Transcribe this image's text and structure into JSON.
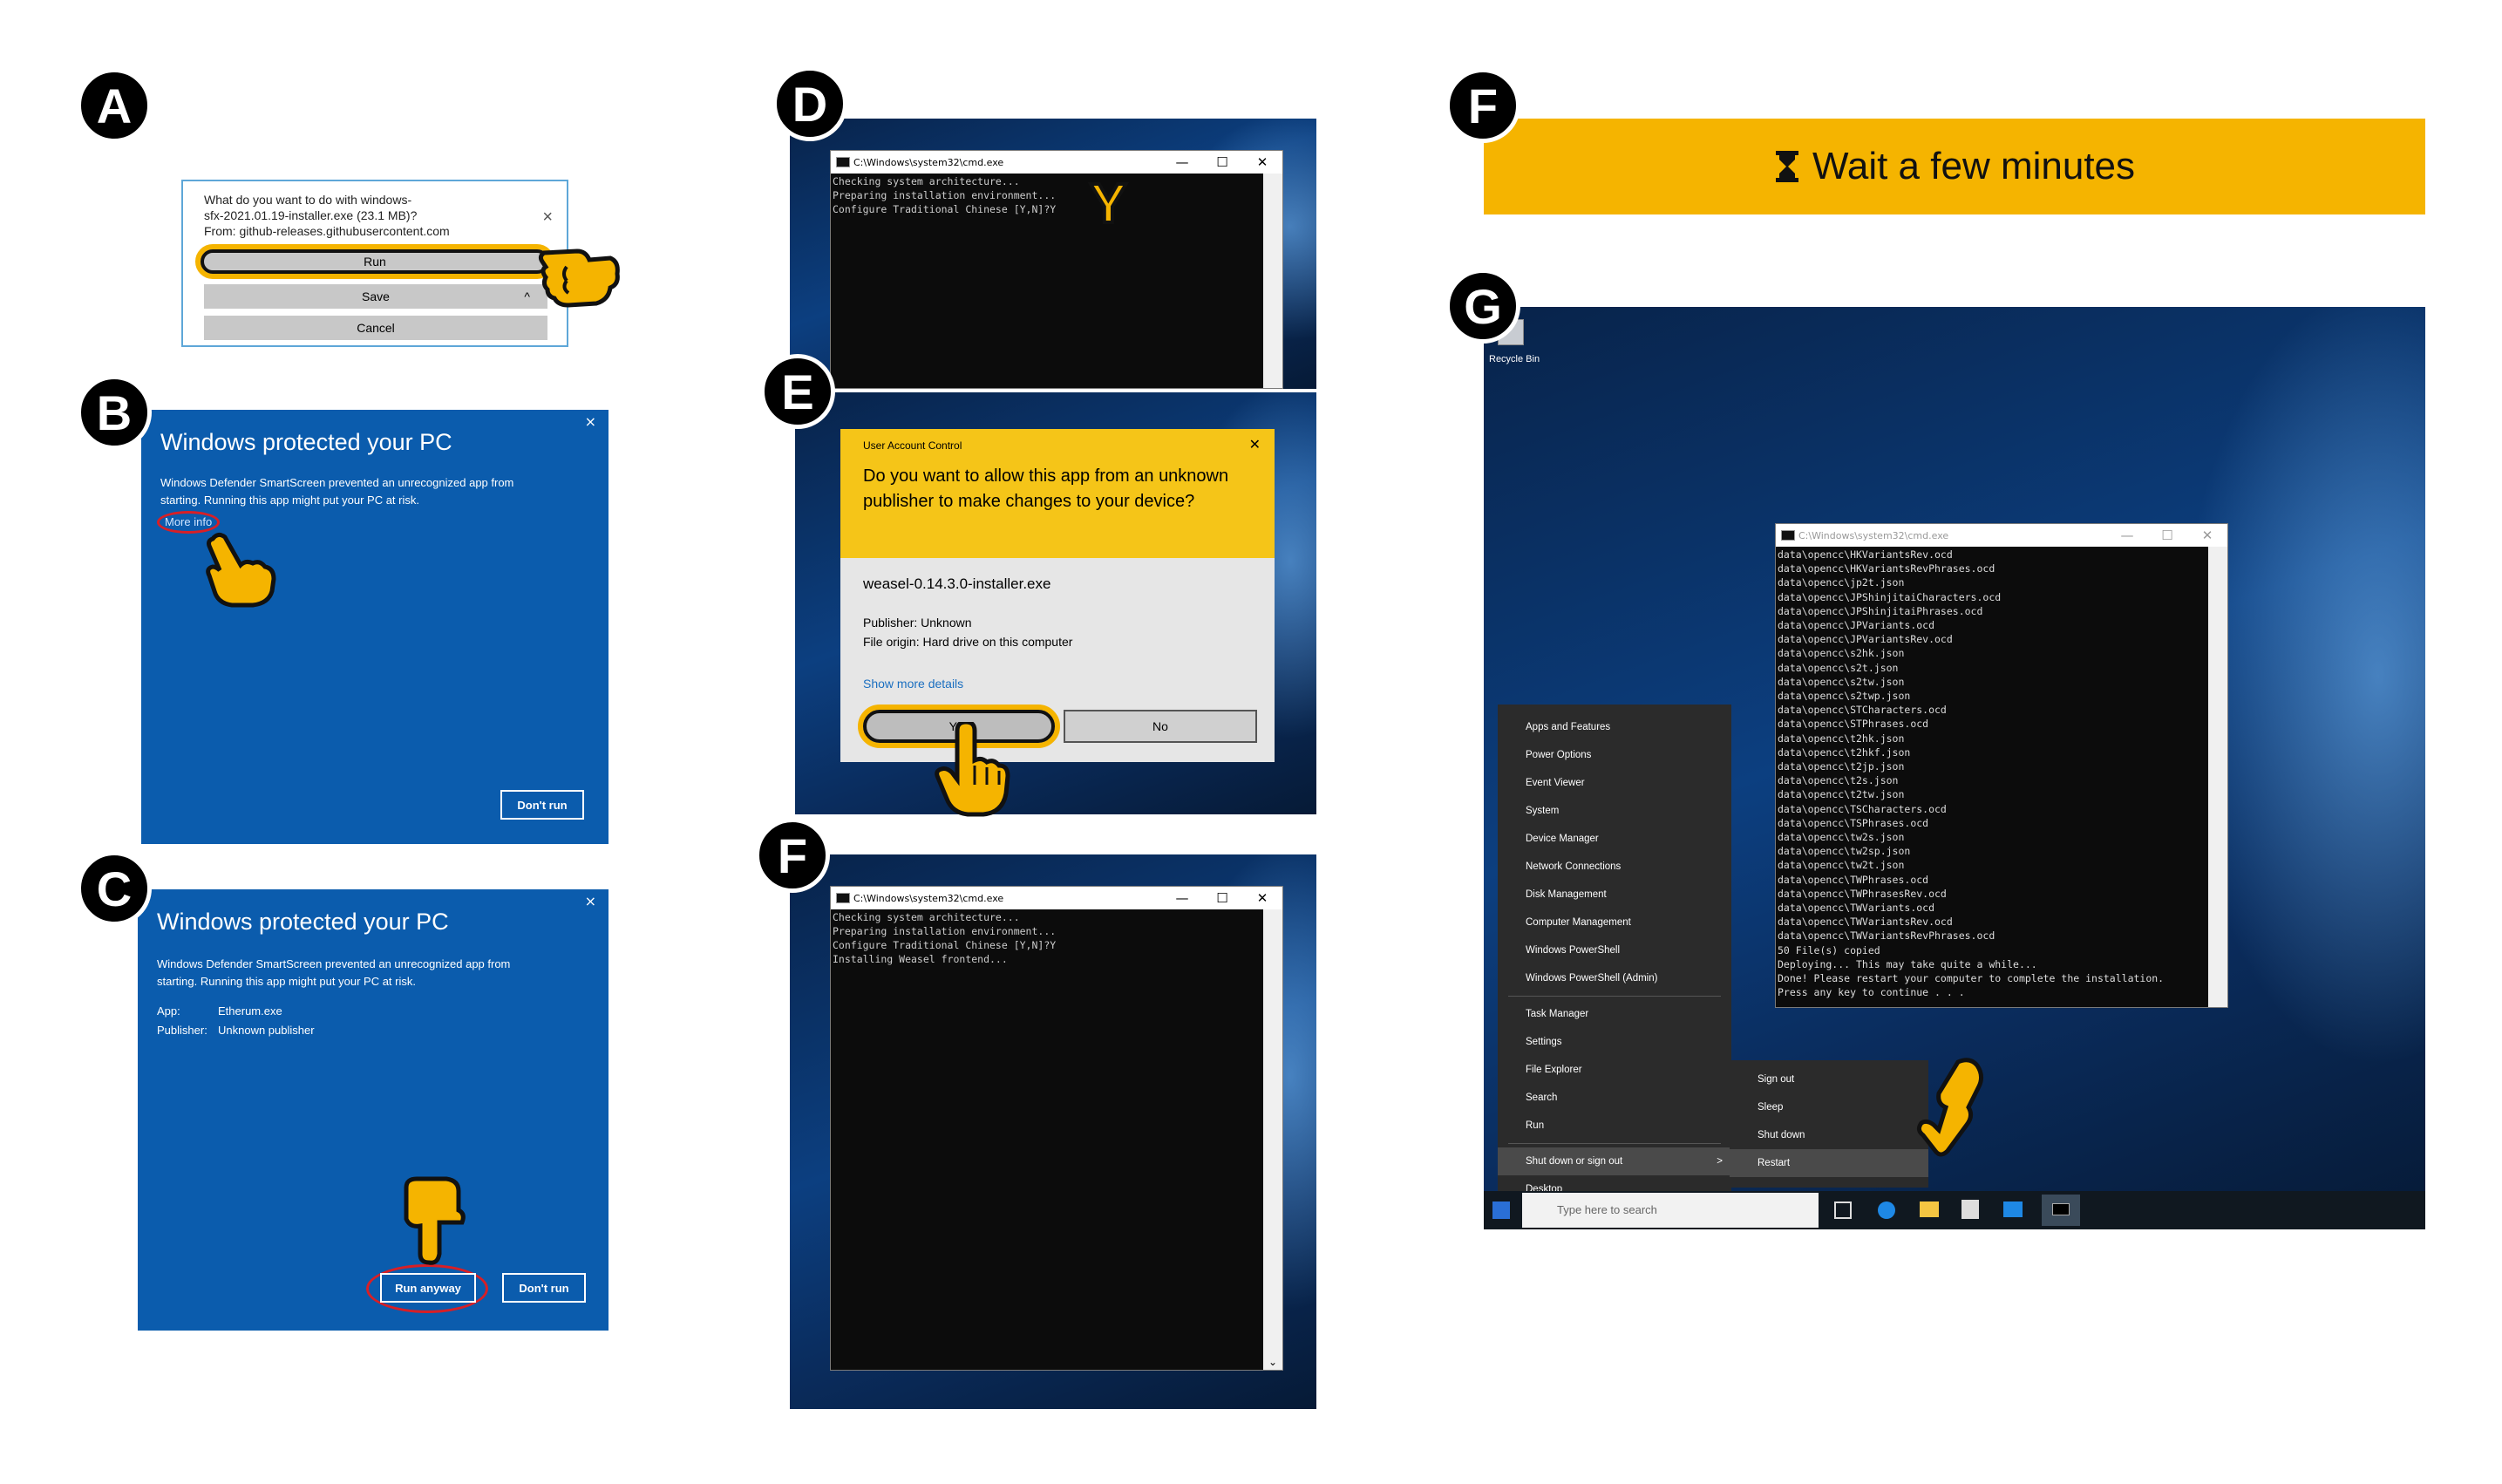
{
  "steps": {
    "a": "A",
    "b": "B",
    "c": "C",
    "d": "D",
    "e": "E",
    "f1": "F",
    "f2": "F",
    "g": "G"
  },
  "panel_a": {
    "prompt_line1": "What do you want to do with windows-",
    "prompt_line2": "sfx-2021.01.19-installer.exe (23.1 MB)?",
    "prompt_line3": "From: github-releases.githubusercontent.com",
    "close": "×",
    "run": "Run",
    "save": "Save",
    "caret": "^",
    "cancel": "Cancel"
  },
  "panel_b": {
    "title": "Windows protected your PC",
    "message_line1": "Windows Defender SmartScreen prevented an unrecognized app from",
    "message_line2": "starting. Running this app might put your PC at risk.",
    "more_info": "More info",
    "dont_run": "Don't run",
    "close": "×"
  },
  "panel_c": {
    "title": "Windows protected your PC",
    "message_line1": "Windows Defender SmartScreen prevented an unrecognized app from",
    "message_line2": "starting. Running this app might put your PC at risk.",
    "app_label": "App:",
    "app_value": "Etherum.exe",
    "publisher_label": "Publisher:",
    "publisher_value": "Unknown publisher",
    "run_anyway": "Run anyway",
    "dont_run": "Don't run",
    "close": "×"
  },
  "panel_d": {
    "window_title": "C:\\Windows\\system32\\cmd.exe",
    "console": "Checking system architecture...\nPreparing installation environment...\nConfigure Traditional Chinese [Y,N]?Y",
    "big_key": "Y",
    "min": "—",
    "max": "☐",
    "close": "✕"
  },
  "panel_e": {
    "header": "User Account Control",
    "question": "Do you want to allow this app from an unknown publisher to make changes to your device?",
    "app_name": "weasel-0.14.3.0-installer.exe",
    "publisher": "Publisher: Unknown",
    "origin": "File origin: Hard drive on this computer",
    "details_link": "Show more details",
    "yes": "Yes",
    "no": "No",
    "close": "✕"
  },
  "panel_f": {
    "window_title": "C:\\Windows\\system32\\cmd.exe",
    "console": "Checking system architecture...\nPreparing installation environment...\nConfigure Traditional Chinese [Y,N]?Y\nInstalling Weasel frontend...",
    "min": "—",
    "max": "☐",
    "close": "✕",
    "scroll_down": "⌄"
  },
  "banner": {
    "icon": "hourglass-icon",
    "text": "Wait a few minutes",
    "color": "#f5b400"
  },
  "panel_g": {
    "recycle_bin": "Recycle Bin",
    "window_title": "C:\\Windows\\system32\\cmd.exe",
    "console": "data\\opencc\\HKVariantsRev.ocd\ndata\\opencc\\HKVariantsRevPhrases.ocd\ndata\\opencc\\jp2t.json\ndata\\opencc\\JPShinjitaiCharacters.ocd\ndata\\opencc\\JPShinjitaiPhrases.ocd\ndata\\opencc\\JPVariants.ocd\ndata\\opencc\\JPVariantsRev.ocd\ndata\\opencc\\s2hk.json\ndata\\opencc\\s2t.json\ndata\\opencc\\s2tw.json\ndata\\opencc\\s2twp.json\ndata\\opencc\\STCharacters.ocd\ndata\\opencc\\STPhrases.ocd\ndata\\opencc\\t2hk.json\ndata\\opencc\\t2hkf.json\ndata\\opencc\\t2jp.json\ndata\\opencc\\t2s.json\ndata\\opencc\\t2tw.json\ndata\\opencc\\TSCharacters.ocd\ndata\\opencc\\TSPhrases.ocd\ndata\\opencc\\tw2s.json\ndata\\opencc\\tw2sp.json\ndata\\opencc\\tw2t.json\ndata\\opencc\\TWPhrases.ocd\ndata\\opencc\\TWPhrasesRev.ocd\ndata\\opencc\\TWVariants.ocd\ndata\\opencc\\TWVariantsRev.ocd\ndata\\opencc\\TWVariantsRevPhrases.ocd\n50 File(s) copied\nDeploying... This may take quite a while...\nDone! Please restart your computer to complete the installation.\nPress any key to continue . . .",
    "menu": [
      "Apps and Features",
      "Power Options",
      "Event Viewer",
      "System",
      "Device Manager",
      "Network Connections",
      "Disk Management",
      "Computer Management",
      "Windows PowerShell",
      "Windows PowerShell (Admin)"
    ],
    "menu2": [
      "Task Manager",
      "Settings",
      "File Explorer",
      "Search",
      "Run"
    ],
    "shutdown": "Shut down or sign out",
    "desktop": "Desktop",
    "submenu": [
      "Sign out",
      "Sleep",
      "Shut down",
      "Restart"
    ],
    "search_placeholder": "Type here to search",
    "submenu_arrow": ">"
  }
}
